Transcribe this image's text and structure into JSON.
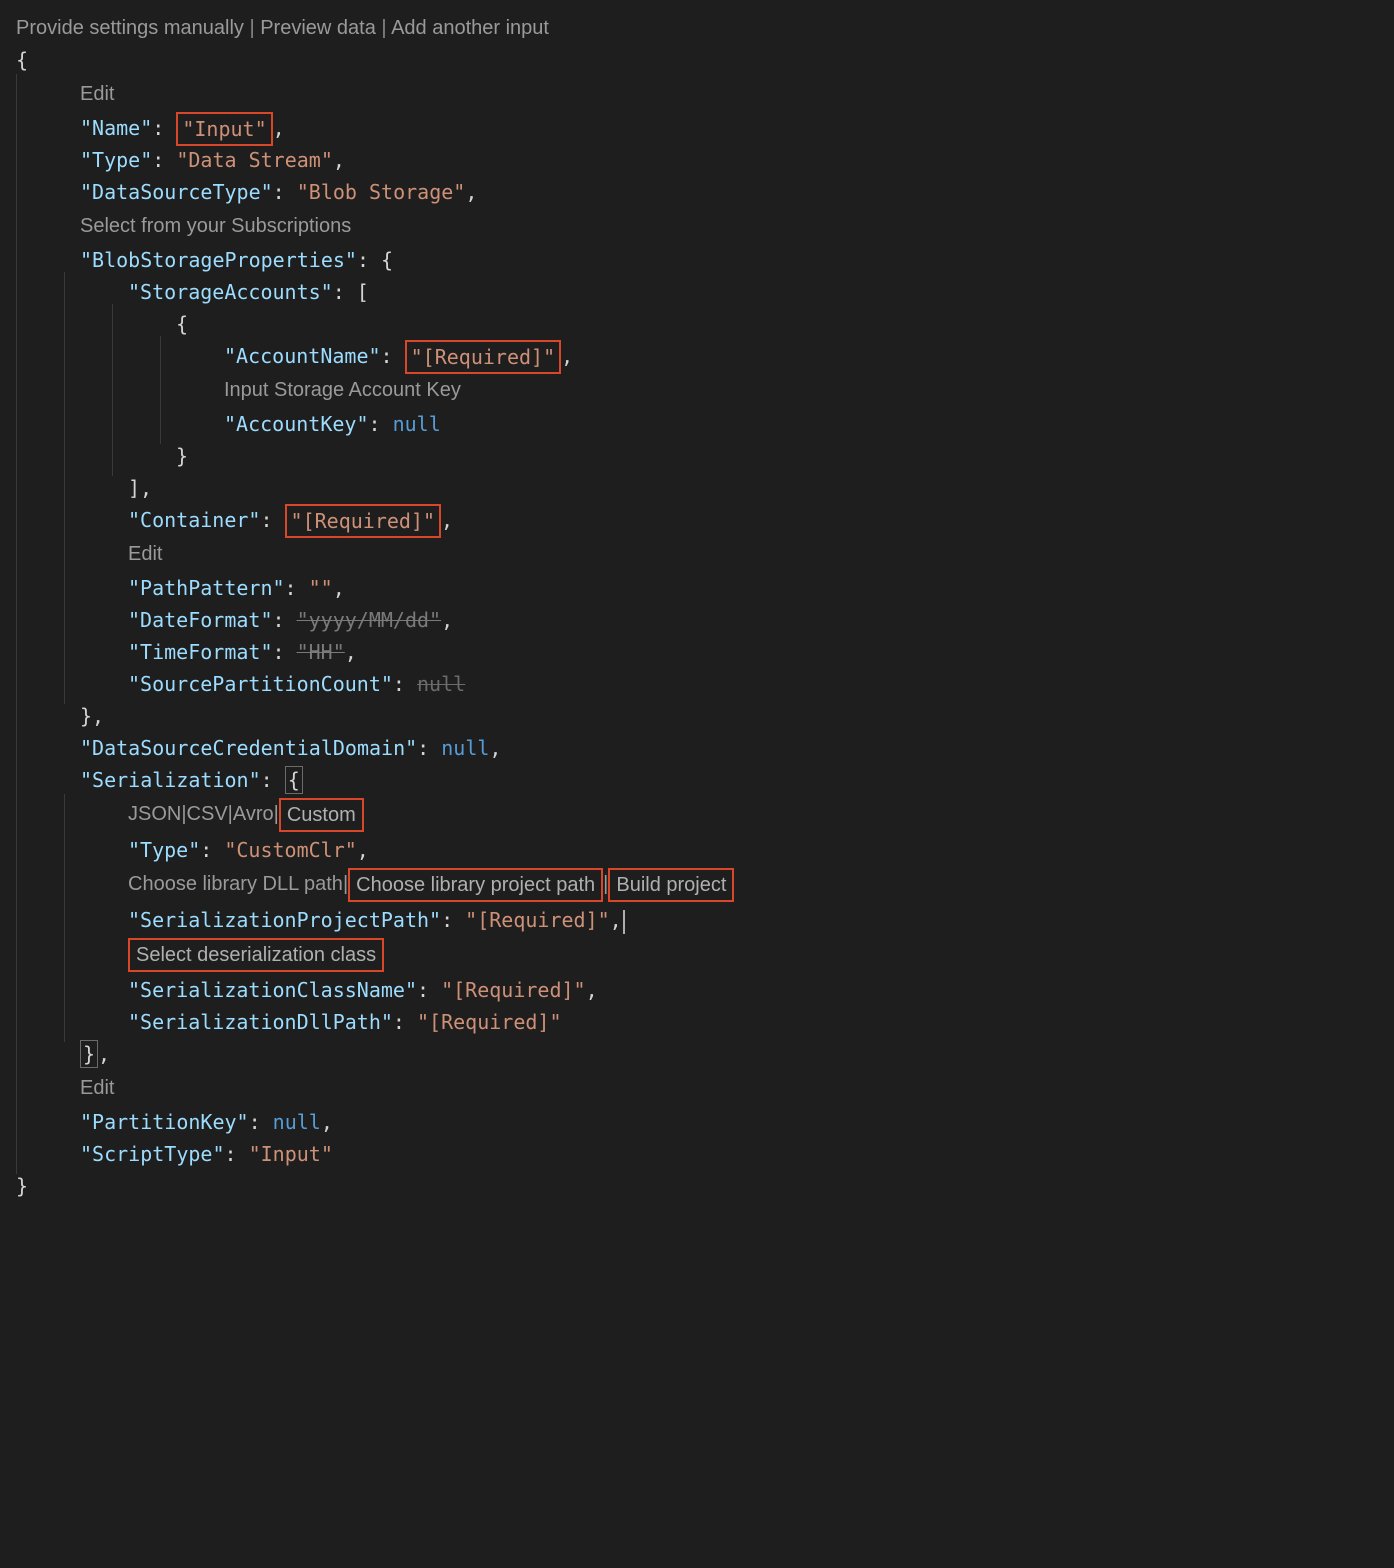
{
  "topLinks": {
    "provide": "Provide settings manually",
    "preview": "Preview data",
    "addInput": "Add another input"
  },
  "hints": {
    "edit1": "Edit",
    "selectSubs": "Select from your Subscriptions",
    "storageKey": "Input Storage Account Key",
    "edit2": "Edit",
    "serFormats": {
      "json": "JSON",
      "csv": "CSV",
      "avro": "Avro",
      "custom": "Custom"
    },
    "libPath": {
      "dll": "Choose library DLL path",
      "proj": "Choose library project path",
      "build": "Build project"
    },
    "selectDeser": "Select deserialization class",
    "edit3": "Edit"
  },
  "json": {
    "Name": {
      "k": "\"Name\"",
      "v": "\"Input\""
    },
    "Type": {
      "k": "\"Type\"",
      "v": "\"Data Stream\""
    },
    "DataSourceType": {
      "k": "\"DataSourceType\"",
      "v": "\"Blob Storage\""
    },
    "BlobStorageProperties": {
      "k": "\"BlobStorageProperties\""
    },
    "StorageAccounts": {
      "k": "\"StorageAccounts\""
    },
    "AccountName": {
      "k": "\"AccountName\"",
      "v": "\"[Required]\""
    },
    "AccountKey": {
      "k": "\"AccountKey\"",
      "v": "null"
    },
    "Container": {
      "k": "\"Container\"",
      "v": "\"[Required]\""
    },
    "PathPattern": {
      "k": "\"PathPattern\"",
      "v": "\"\""
    },
    "DateFormat": {
      "k": "\"DateFormat\"",
      "v": "\"yyyy/MM/dd\""
    },
    "TimeFormat": {
      "k": "\"TimeFormat\"",
      "v": "\"HH\""
    },
    "SourcePartitionCount": {
      "k": "\"SourcePartitionCount\"",
      "v": "null"
    },
    "DataSourceCredentialDomain": {
      "k": "\"DataSourceCredentialDomain\"",
      "v": "null"
    },
    "Serialization": {
      "k": "\"Serialization\""
    },
    "SerType": {
      "k": "\"Type\"",
      "v": "\"CustomClr\""
    },
    "SerializationProjectPath": {
      "k": "\"SerializationProjectPath\"",
      "v": "\"[Required]\""
    },
    "SerializationClassName": {
      "k": "\"SerializationClassName\"",
      "v": "\"[Required]\""
    },
    "SerializationDllPath": {
      "k": "\"SerializationDllPath\"",
      "v": "\"[Required]\""
    },
    "PartitionKey": {
      "k": "\"PartitionKey\"",
      "v": "null"
    },
    "ScriptType": {
      "k": "\"ScriptType\"",
      "v": "\"Input\""
    }
  }
}
